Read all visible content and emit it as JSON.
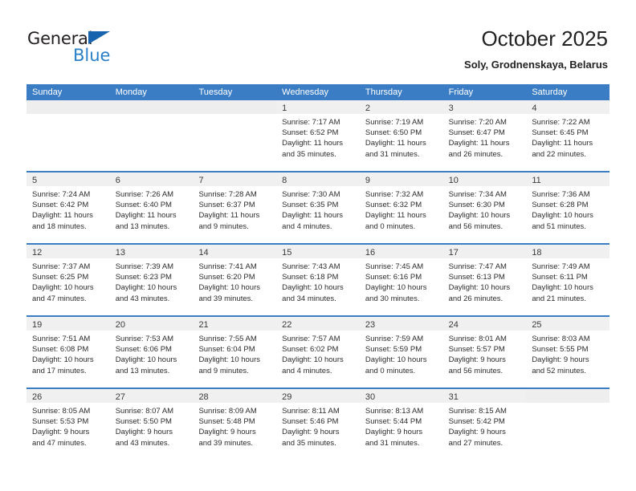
{
  "brand": {
    "name_part1": "General",
    "name_part2": "Blue",
    "triangle_color": "#1763ad",
    "blue_color": "#2a80c8"
  },
  "header": {
    "title": "October 2025",
    "subtitle": "Soly, Grodnenskaya, Belarus"
  },
  "theme": {
    "header_blue": "#3b7dc4",
    "daynum_band": "#f0f0f0",
    "empty_band": "#eeeeee",
    "text": "#2b2b2b"
  },
  "weekdays": [
    "Sunday",
    "Monday",
    "Tuesday",
    "Wednesday",
    "Thursday",
    "Friday",
    "Saturday"
  ],
  "chart_data": {
    "type": "table",
    "title": "October 2025",
    "subtitle": "Soly, Grodnenskaya, Belarus",
    "columns": [
      "Sunday",
      "Monday",
      "Tuesday",
      "Wednesday",
      "Thursday",
      "Friday",
      "Saturday"
    ],
    "rows": [
      [
        {
          "day": "",
          "empty": true
        },
        {
          "day": "",
          "empty": true
        },
        {
          "day": "",
          "empty": true
        },
        {
          "day": "1",
          "sunrise": "Sunrise: 7:17 AM",
          "sunset": "Sunset: 6:52 PM",
          "daylight_1": "Daylight: 11 hours",
          "daylight_2": "and 35 minutes."
        },
        {
          "day": "2",
          "sunrise": "Sunrise: 7:19 AM",
          "sunset": "Sunset: 6:50 PM",
          "daylight_1": "Daylight: 11 hours",
          "daylight_2": "and 31 minutes."
        },
        {
          "day": "3",
          "sunrise": "Sunrise: 7:20 AM",
          "sunset": "Sunset: 6:47 PM",
          "daylight_1": "Daylight: 11 hours",
          "daylight_2": "and 26 minutes."
        },
        {
          "day": "4",
          "sunrise": "Sunrise: 7:22 AM",
          "sunset": "Sunset: 6:45 PM",
          "daylight_1": "Daylight: 11 hours",
          "daylight_2": "and 22 minutes."
        }
      ],
      [
        {
          "day": "5",
          "sunrise": "Sunrise: 7:24 AM",
          "sunset": "Sunset: 6:42 PM",
          "daylight_1": "Daylight: 11 hours",
          "daylight_2": "and 18 minutes."
        },
        {
          "day": "6",
          "sunrise": "Sunrise: 7:26 AM",
          "sunset": "Sunset: 6:40 PM",
          "daylight_1": "Daylight: 11 hours",
          "daylight_2": "and 13 minutes."
        },
        {
          "day": "7",
          "sunrise": "Sunrise: 7:28 AM",
          "sunset": "Sunset: 6:37 PM",
          "daylight_1": "Daylight: 11 hours",
          "daylight_2": "and 9 minutes."
        },
        {
          "day": "8",
          "sunrise": "Sunrise: 7:30 AM",
          "sunset": "Sunset: 6:35 PM",
          "daylight_1": "Daylight: 11 hours",
          "daylight_2": "and 4 minutes."
        },
        {
          "day": "9",
          "sunrise": "Sunrise: 7:32 AM",
          "sunset": "Sunset: 6:32 PM",
          "daylight_1": "Daylight: 11 hours",
          "daylight_2": "and 0 minutes."
        },
        {
          "day": "10",
          "sunrise": "Sunrise: 7:34 AM",
          "sunset": "Sunset: 6:30 PM",
          "daylight_1": "Daylight: 10 hours",
          "daylight_2": "and 56 minutes."
        },
        {
          "day": "11",
          "sunrise": "Sunrise: 7:36 AM",
          "sunset": "Sunset: 6:28 PM",
          "daylight_1": "Daylight: 10 hours",
          "daylight_2": "and 51 minutes."
        }
      ],
      [
        {
          "day": "12",
          "sunrise": "Sunrise: 7:37 AM",
          "sunset": "Sunset: 6:25 PM",
          "daylight_1": "Daylight: 10 hours",
          "daylight_2": "and 47 minutes."
        },
        {
          "day": "13",
          "sunrise": "Sunrise: 7:39 AM",
          "sunset": "Sunset: 6:23 PM",
          "daylight_1": "Daylight: 10 hours",
          "daylight_2": "and 43 minutes."
        },
        {
          "day": "14",
          "sunrise": "Sunrise: 7:41 AM",
          "sunset": "Sunset: 6:20 PM",
          "daylight_1": "Daylight: 10 hours",
          "daylight_2": "and 39 minutes."
        },
        {
          "day": "15",
          "sunrise": "Sunrise: 7:43 AM",
          "sunset": "Sunset: 6:18 PM",
          "daylight_1": "Daylight: 10 hours",
          "daylight_2": "and 34 minutes."
        },
        {
          "day": "16",
          "sunrise": "Sunrise: 7:45 AM",
          "sunset": "Sunset: 6:16 PM",
          "daylight_1": "Daylight: 10 hours",
          "daylight_2": "and 30 minutes."
        },
        {
          "day": "17",
          "sunrise": "Sunrise: 7:47 AM",
          "sunset": "Sunset: 6:13 PM",
          "daylight_1": "Daylight: 10 hours",
          "daylight_2": "and 26 minutes."
        },
        {
          "day": "18",
          "sunrise": "Sunrise: 7:49 AM",
          "sunset": "Sunset: 6:11 PM",
          "daylight_1": "Daylight: 10 hours",
          "daylight_2": "and 21 minutes."
        }
      ],
      [
        {
          "day": "19",
          "sunrise": "Sunrise: 7:51 AM",
          "sunset": "Sunset: 6:08 PM",
          "daylight_1": "Daylight: 10 hours",
          "daylight_2": "and 17 minutes."
        },
        {
          "day": "20",
          "sunrise": "Sunrise: 7:53 AM",
          "sunset": "Sunset: 6:06 PM",
          "daylight_1": "Daylight: 10 hours",
          "daylight_2": "and 13 minutes."
        },
        {
          "day": "21",
          "sunrise": "Sunrise: 7:55 AM",
          "sunset": "Sunset: 6:04 PM",
          "daylight_1": "Daylight: 10 hours",
          "daylight_2": "and 9 minutes."
        },
        {
          "day": "22",
          "sunrise": "Sunrise: 7:57 AM",
          "sunset": "Sunset: 6:02 PM",
          "daylight_1": "Daylight: 10 hours",
          "daylight_2": "and 4 minutes."
        },
        {
          "day": "23",
          "sunrise": "Sunrise: 7:59 AM",
          "sunset": "Sunset: 5:59 PM",
          "daylight_1": "Daylight: 10 hours",
          "daylight_2": "and 0 minutes."
        },
        {
          "day": "24",
          "sunrise": "Sunrise: 8:01 AM",
          "sunset": "Sunset: 5:57 PM",
          "daylight_1": "Daylight: 9 hours",
          "daylight_2": "and 56 minutes."
        },
        {
          "day": "25",
          "sunrise": "Sunrise: 8:03 AM",
          "sunset": "Sunset: 5:55 PM",
          "daylight_1": "Daylight: 9 hours",
          "daylight_2": "and 52 minutes."
        }
      ],
      [
        {
          "day": "26",
          "sunrise": "Sunrise: 8:05 AM",
          "sunset": "Sunset: 5:53 PM",
          "daylight_1": "Daylight: 9 hours",
          "daylight_2": "and 47 minutes."
        },
        {
          "day": "27",
          "sunrise": "Sunrise: 8:07 AM",
          "sunset": "Sunset: 5:50 PM",
          "daylight_1": "Daylight: 9 hours",
          "daylight_2": "and 43 minutes."
        },
        {
          "day": "28",
          "sunrise": "Sunrise: 8:09 AM",
          "sunset": "Sunset: 5:48 PM",
          "daylight_1": "Daylight: 9 hours",
          "daylight_2": "and 39 minutes."
        },
        {
          "day": "29",
          "sunrise": "Sunrise: 8:11 AM",
          "sunset": "Sunset: 5:46 PM",
          "daylight_1": "Daylight: 9 hours",
          "daylight_2": "and 35 minutes."
        },
        {
          "day": "30",
          "sunrise": "Sunrise: 8:13 AM",
          "sunset": "Sunset: 5:44 PM",
          "daylight_1": "Daylight: 9 hours",
          "daylight_2": "and 31 minutes."
        },
        {
          "day": "31",
          "sunrise": "Sunrise: 8:15 AM",
          "sunset": "Sunset: 5:42 PM",
          "daylight_1": "Daylight: 9 hours",
          "daylight_2": "and 27 minutes."
        },
        {
          "day": "",
          "empty": true
        }
      ]
    ]
  }
}
